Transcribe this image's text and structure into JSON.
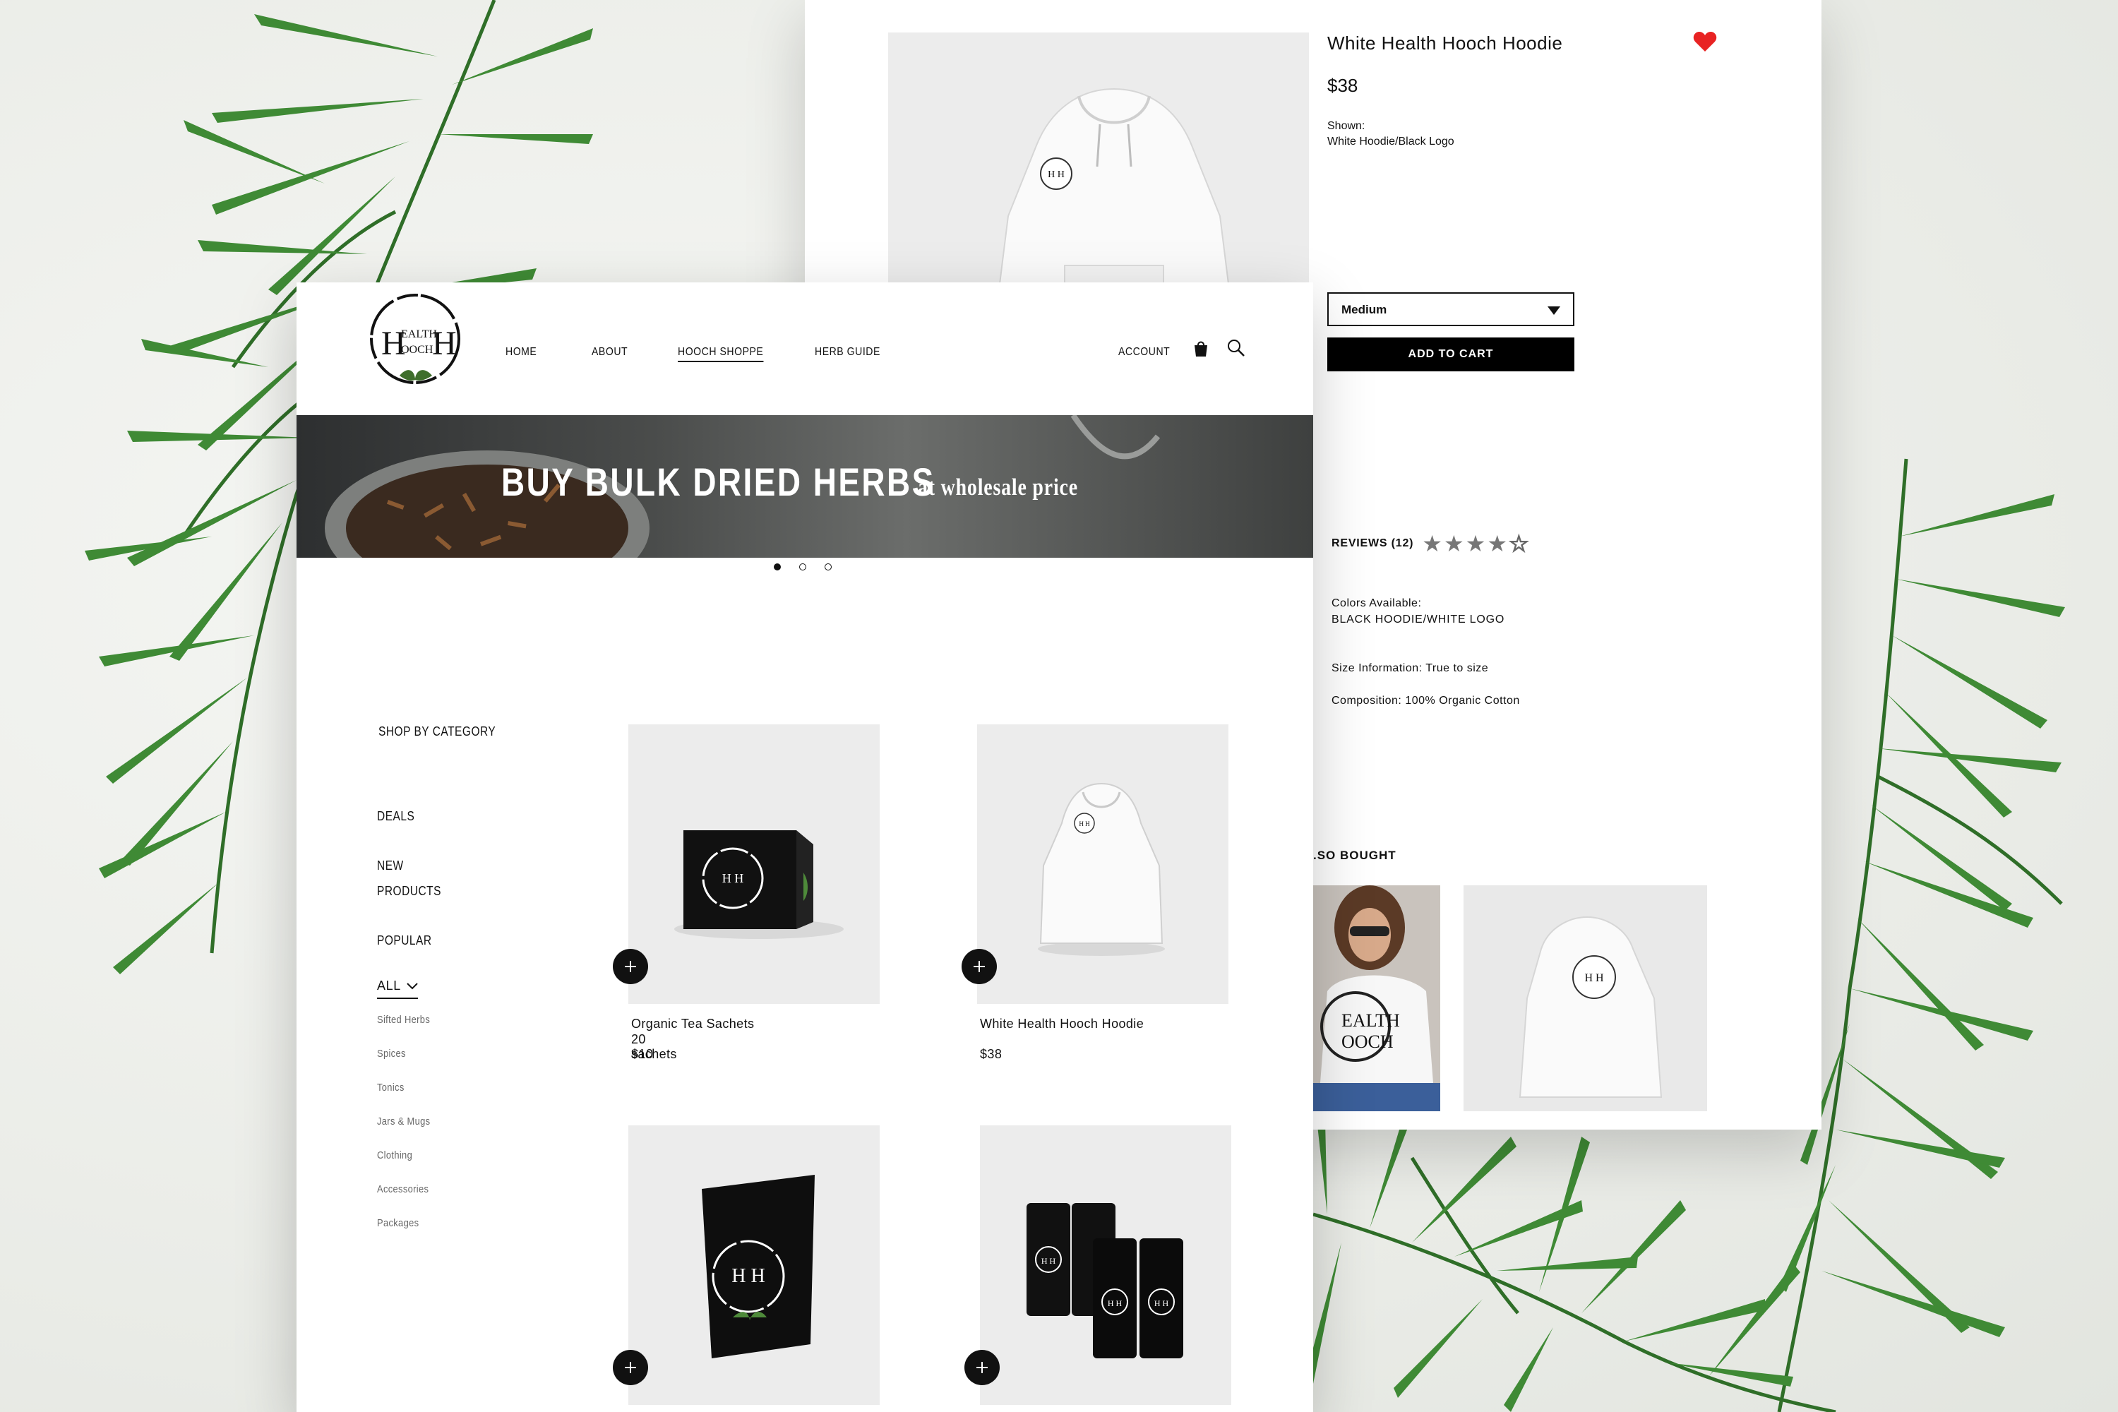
{
  "colors": {
    "accent": "#000000",
    "heart": "#e82323",
    "text": "#111111",
    "muted": "#666666",
    "thumb_bg": "#ececec"
  },
  "brand": {
    "logo_text_top": "EALTH",
    "logo_text_bottom": "OOCH",
    "logo_letter": "H"
  },
  "nav": {
    "items": [
      {
        "label": "HOME",
        "active": false
      },
      {
        "label": "ABOUT",
        "active": false
      },
      {
        "label": "HOOCH SHOPPE",
        "active": true
      },
      {
        "label": "HERB GUIDE",
        "active": false
      }
    ],
    "account": "ACCOUNT",
    "icons": [
      "shopping-bag-icon",
      "search-icon"
    ]
  },
  "hero": {
    "main": "BUY BULK DRIED HERBS",
    "sub": "at wholesale price",
    "slides": 3,
    "active_slide": 1
  },
  "sidebar": {
    "heading": "SHOP BY CATEGORY",
    "main_items": [
      "DEALS",
      "NEW PRODUCTS",
      "POPULAR"
    ],
    "all_label": "ALL",
    "sub_items": [
      "Sifted Herbs",
      "Spices",
      "Tonics",
      "Jars & Mugs",
      "Clothing",
      "Accessories",
      "Packages"
    ]
  },
  "products": [
    {
      "name": "Organic Tea Sachets",
      "detail": "20 sachets",
      "price": "$10"
    },
    {
      "name": "White Health Hooch Hoodie",
      "detail": "",
      "price": "$38"
    },
    {
      "name": "",
      "detail": "",
      "price": ""
    },
    {
      "name": "",
      "detail": "",
      "price": ""
    }
  ],
  "product_detail": {
    "title": "White Health Hooch Hoodie",
    "price": "$38",
    "shown_label": "Shown:",
    "shown_value": "White Hoodie/Black Logo",
    "size_selected": "Medium",
    "add_to_cart": "ADD TO CART",
    "reviews_label": "REVIEWS (12)",
    "rating": 4,
    "rating_max": 5,
    "colors_label": "Colors Available:",
    "colors_value": "BLACK HOODIE/WHITE LOGO",
    "size_info": "Size Information: True to size",
    "composition": "Composition: 100% Organic Cotton",
    "also_bought": ".SO BOUGHT"
  }
}
